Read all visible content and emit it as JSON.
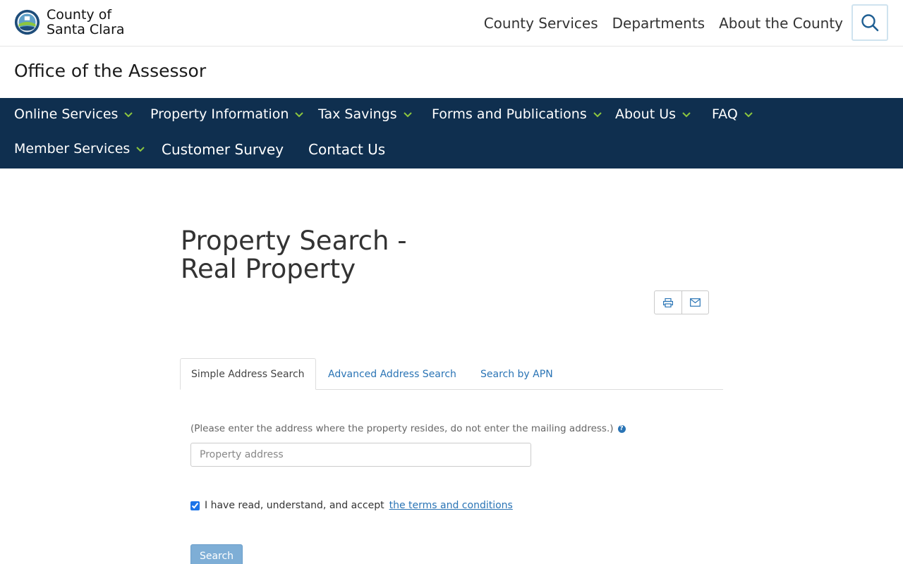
{
  "header": {
    "county_line1": "County of",
    "county_line2": "Santa Clara",
    "nav": [
      "County Services",
      "Departments",
      "About the County"
    ]
  },
  "office_title": "Office of the Assessor",
  "main_nav": {
    "row1": [
      "Online Services",
      "Property Information",
      "Tax Savings",
      "Forms and Publications",
      "About Us",
      "FAQ"
    ],
    "row2_dropdown": "Member Services",
    "row2_links": [
      "Customer Survey",
      "Contact Us"
    ]
  },
  "page": {
    "title_line1": "Property Search -",
    "title_line2": "Real Property"
  },
  "tabs": [
    "Simple Address Search",
    "Advanced Address Search",
    "Search by APN"
  ],
  "form": {
    "hint": "(Please enter the address where the property resides, do not enter the mailing address.)",
    "address_placeholder": "Property address",
    "terms_text": "I have read, understand, and accept",
    "terms_link": "the terms and conditions",
    "terms_checked": true,
    "search_label": "Search"
  },
  "colors": {
    "nav_bg": "#0f2f4f",
    "chevron": "#8cc63f",
    "link": "#2a74b5"
  },
  "icons": [
    "county-seal-logo",
    "search-icon",
    "chevron-down-icon",
    "print-icon",
    "email-icon",
    "help-icon"
  ]
}
